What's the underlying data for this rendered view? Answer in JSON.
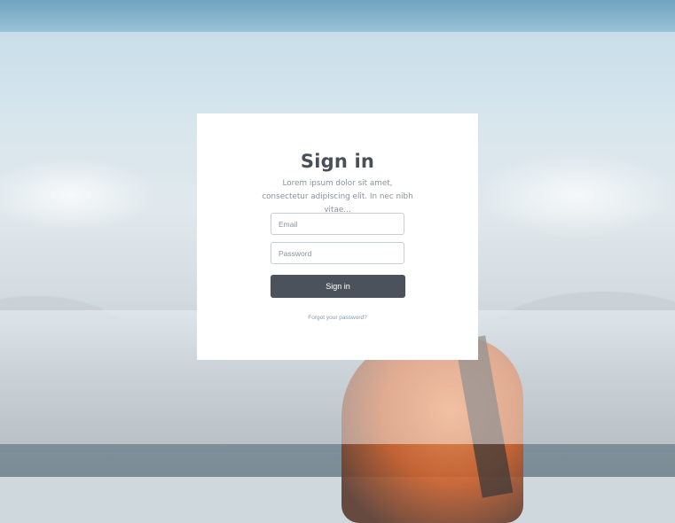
{
  "login": {
    "title": "Sign in",
    "subtitle": "Lorem ipsum dolor sit amet, consectetur adipiscing elit. In nec nibh vitae...",
    "email_placeholder": "Email",
    "password_placeholder": "Password",
    "submit_label": "Sign in",
    "forgot_link": "Forgot your password?"
  },
  "colors": {
    "button_bg": "#4b525c",
    "title_text": "#4a4f57",
    "link_text": "#7f9bb3"
  }
}
